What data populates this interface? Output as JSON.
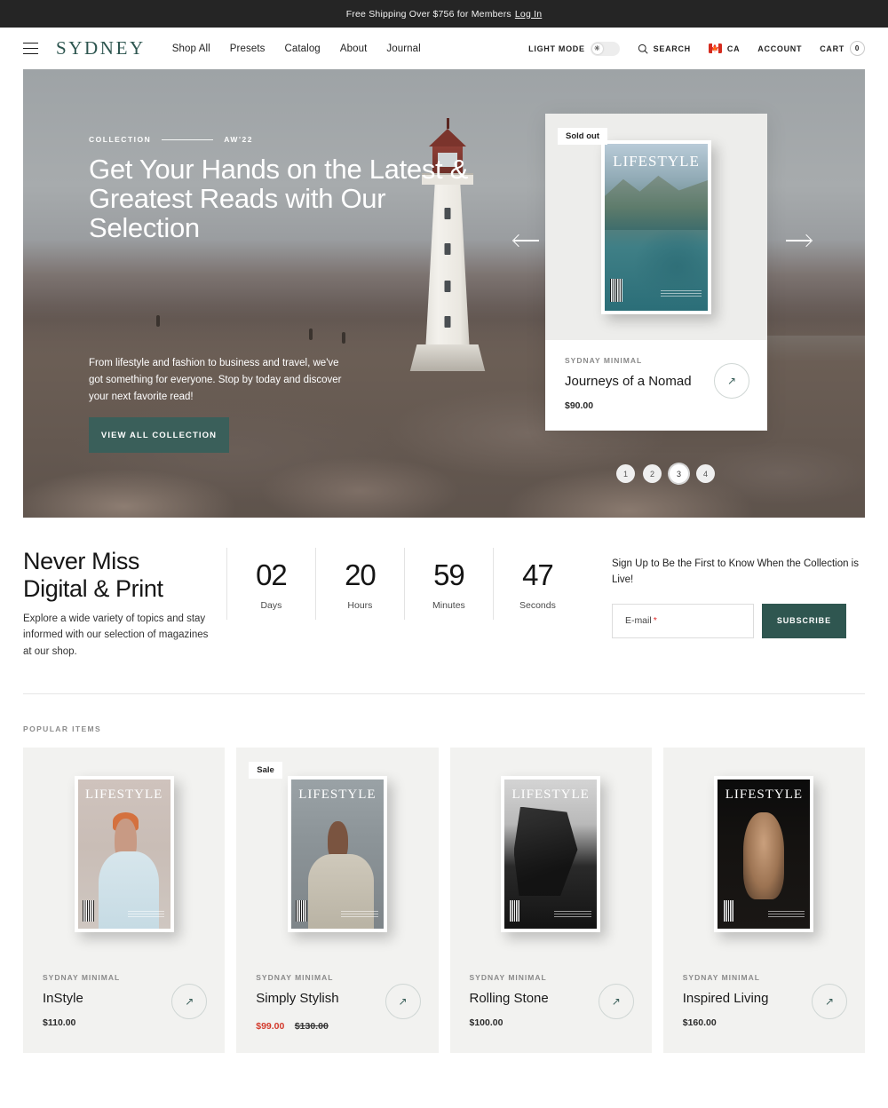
{
  "announcement": {
    "text": "Free Shipping Over $756 for Members",
    "login_label": "Log In"
  },
  "header": {
    "menu_icon": "hamburger-icon",
    "logo": "SYDNEY",
    "nav": [
      {
        "label": "Shop All"
      },
      {
        "label": "Presets"
      },
      {
        "label": "Catalog"
      },
      {
        "label": "About"
      },
      {
        "label": "Journal"
      }
    ],
    "light_mode_label": "LIGHT MODE",
    "light_mode_icon": "sun-icon",
    "search_label": "SEARCH",
    "search_icon": "search-icon",
    "country_code": "CA",
    "country_flag": "canada-flag-icon",
    "account_label": "ACCOUNT",
    "cart_label": "CART",
    "cart_count": "0"
  },
  "hero": {
    "eyebrow_left": "COLLECTION",
    "eyebrow_right": "AW'22",
    "title": "Get Your Hands on the Latest & Greatest Reads with Our Selection",
    "paragraph": "From lifestyle and fashion to business and travel, we've got something for everyone. Stop by today and discover your next favorite read!",
    "cta_label": "VIEW ALL COLLECTION",
    "prev_icon": "arrow-left-icon",
    "next_icon": "arrow-right-icon",
    "card": {
      "badge": "Sold out",
      "vendor": "SYDNAY MINIMAL",
      "title": "Journeys of a Nomad",
      "price": "$90.00",
      "cover_masthead": "LIFESTYLE",
      "arrow_icon": "arrow-up-right-icon"
    },
    "pagination": [
      "1",
      "2",
      "3",
      "4"
    ],
    "pagination_active": "3"
  },
  "countdown": {
    "heading_line1": "Never Miss",
    "heading_line2": "Digital & Print",
    "paragraph": "Explore a wide variety of topics and stay informed with our selection of magazines at our shop.",
    "timers": [
      {
        "value": "02",
        "label": "Days"
      },
      {
        "value": "20",
        "label": "Hours"
      },
      {
        "value": "59",
        "label": "Minutes"
      },
      {
        "value": "47",
        "label": "Seconds"
      }
    ],
    "signup_text": "Sign Up to Be the First to Know When the Collection is Live!",
    "email_placeholder": "E-mail",
    "email_required_mark": "*",
    "subscribe_label": "SUBSCRIBE"
  },
  "popular": {
    "section_label": "POPULAR ITEMS",
    "items": [
      {
        "vendor": "SYDNAY MINIMAL",
        "title": "InStyle",
        "price": "$110.00",
        "compare_price": "",
        "badge": "",
        "cover_masthead": "LIFESTYLE",
        "arrow_icon": "arrow-up-right-icon"
      },
      {
        "vendor": "SYDNAY MINIMAL",
        "title": "Simply Stylish",
        "price": "$99.00",
        "compare_price": "$130.00",
        "badge": "Sale",
        "cover_masthead": "LIFESTYLE",
        "arrow_icon": "arrow-up-right-icon"
      },
      {
        "vendor": "SYDNAY MINIMAL",
        "title": "Rolling Stone",
        "price": "$100.00",
        "compare_price": "",
        "badge": "",
        "cover_masthead": "LIFESTYLE",
        "arrow_icon": "arrow-up-right-icon"
      },
      {
        "vendor": "SYDNAY MINIMAL",
        "title": "Inspired Living",
        "price": "$160.00",
        "compare_price": "",
        "badge": "",
        "cover_masthead": "LIFESTYLE",
        "arrow_icon": "arrow-up-right-icon"
      }
    ]
  },
  "colors": {
    "brand_green": "#2f5650",
    "announce_bg": "#252525",
    "sale_red": "#d33a2c",
    "card_bg": "#f2f2f0"
  }
}
